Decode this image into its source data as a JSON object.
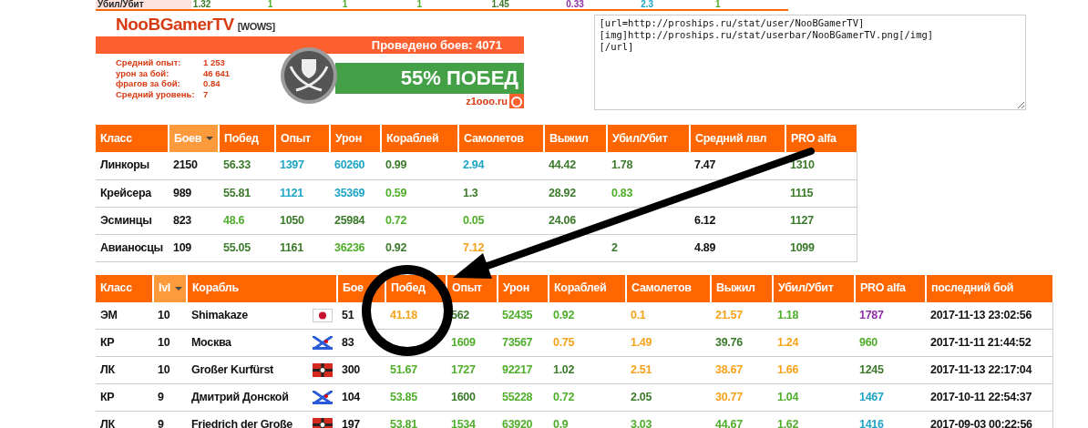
{
  "top_strip": {
    "label": "Убил/Убит",
    "values": [
      {
        "text": "1.32",
        "color": "#3b7a2a"
      },
      {
        "text": "1",
        "color": "#4fae2a"
      },
      {
        "text": "1",
        "color": "#4fae2a"
      },
      {
        "text": "1",
        "color": "#4fae2a"
      },
      {
        "text": "1.45",
        "color": "#3b7a2a"
      },
      {
        "text": "0.33",
        "color": "#8d2fa5"
      },
      {
        "text": "2.3",
        "color": "#1ea5c5"
      },
      {
        "text": "1",
        "color": "#4fae2a"
      }
    ]
  },
  "userbar": {
    "name": "NooBGamerTV",
    "tag": "[WOWS]",
    "battles": "Проведено боев: 4071",
    "stats": [
      {
        "label": "Средний опыт:",
        "value": "1 253"
      },
      {
        "label": "урон за бой:",
        "value": "46 641"
      },
      {
        "label": "фрагов за бой:",
        "value": "0.84"
      },
      {
        "label": "Средний уровень:",
        "value": "7"
      }
    ],
    "wins": "55% ПОБЕД",
    "site": "z1ooo.ru"
  },
  "code_field": {
    "value": "[url=http://proships.ru/stat/user/NooBGamerTV]\n[img]http://proships.ru/stat/userbar/NooBGamerTV.png[/img]\n[/url]"
  },
  "class_table": {
    "columns": [
      {
        "label": "Класс",
        "sorted": false
      },
      {
        "label": "Боев",
        "sorted": true
      },
      {
        "label": "Побед",
        "sorted": false
      },
      {
        "label": "Опыт",
        "sorted": false
      },
      {
        "label": "Урон",
        "sorted": false
      },
      {
        "label": "Кораблей",
        "sorted": false
      },
      {
        "label": "Самолетов",
        "sorted": false
      },
      {
        "label": "Выжил",
        "sorted": false
      },
      {
        "label": "Убил/Убит",
        "sorted": false
      },
      {
        "label": "Средний лвл",
        "sorted": false
      },
      {
        "label": "PRO alfa",
        "sorted": false
      }
    ],
    "rows": [
      {
        "cells": [
          {
            "text": "Линкоры"
          },
          {
            "text": "2150"
          },
          {
            "text": "56.33",
            "color": "#3b7a2a"
          },
          {
            "text": "1397",
            "color": "#1ea5c5"
          },
          {
            "text": "60260",
            "color": "#1ea5c5"
          },
          {
            "text": "0.99",
            "color": "#3b7a2a"
          },
          {
            "text": "2.94",
            "color": "#1ea5c5"
          },
          {
            "text": "44.42",
            "color": "#3b7a2a"
          },
          {
            "text": "1.78",
            "color": "#3b7a2a"
          },
          {
            "text": "7.47",
            "color": "#111111"
          },
          {
            "text": "1310",
            "color": "#3b7a2a"
          }
        ]
      },
      {
        "cells": [
          {
            "text": "Крейсера"
          },
          {
            "text": "989"
          },
          {
            "text": "55.81",
            "color": "#3b7a2a"
          },
          {
            "text": "1121",
            "color": "#1ea5c5"
          },
          {
            "text": "35369",
            "color": "#1ea5c5"
          },
          {
            "text": "0.59",
            "color": "#4fae2a"
          },
          {
            "text": "1.3",
            "color": "#3b7a2a"
          },
          {
            "text": "28.92",
            "color": "#3b7a2a"
          },
          {
            "text": "0.83",
            "color": "#4fae2a"
          },
          {
            "text": ""
          },
          {
            "text": "1115",
            "color": "#3b7a2a"
          }
        ]
      },
      {
        "cells": [
          {
            "text": "Эсминцы"
          },
          {
            "text": "823"
          },
          {
            "text": "48.6",
            "color": "#4fae2a"
          },
          {
            "text": "1050",
            "color": "#3b7a2a"
          },
          {
            "text": "25984",
            "color": "#3b7a2a"
          },
          {
            "text": "0.72",
            "color": "#4fae2a"
          },
          {
            "text": "0.05",
            "color": "#4fae2a"
          },
          {
            "text": "24.06",
            "color": "#3b7a2a"
          },
          {
            "text": ""
          },
          {
            "text": "6.12",
            "color": "#111111"
          },
          {
            "text": "1127",
            "color": "#3b7a2a"
          }
        ]
      },
      {
        "cells": [
          {
            "text": "Авианосцы"
          },
          {
            "text": "109"
          },
          {
            "text": "55.05",
            "color": "#3b7a2a"
          },
          {
            "text": "1161",
            "color": "#3b7a2a"
          },
          {
            "text": "36236",
            "color": "#4fae2a"
          },
          {
            "text": "0.92",
            "color": "#3b7a2a"
          },
          {
            "text": "7.12",
            "color": "#f7a21b"
          },
          {
            "text": ""
          },
          {
            "text": "2",
            "color": "#3b7a2a"
          },
          {
            "text": "4.89",
            "color": "#111111"
          },
          {
            "text": "1099",
            "color": "#3b7a2a"
          }
        ]
      }
    ]
  },
  "ship_table": {
    "columns": [
      {
        "label": "Класс",
        "sorted": false
      },
      {
        "label": "lvl",
        "sorted": true
      },
      {
        "label": "Корабль",
        "sorted": false
      },
      {
        "label": "Бое",
        "sorted": false
      },
      {
        "label": "Побед",
        "sorted": false
      },
      {
        "label": "Опыт",
        "sorted": false
      },
      {
        "label": "Урон",
        "sorted": false
      },
      {
        "label": "Кораблей",
        "sorted": false
      },
      {
        "label": "Самолетов",
        "sorted": false
      },
      {
        "label": "Выжил",
        "sorted": false
      },
      {
        "label": "Убил/Убит",
        "sorted": false
      },
      {
        "label": "PRO alfa",
        "sorted": false
      },
      {
        "label": "последний бой",
        "sorted": false
      }
    ],
    "rows": [
      {
        "cells": [
          {
            "text": "ЭМ"
          },
          {
            "text": "10"
          },
          {
            "text": "Shimakaze",
            "kind": "japan"
          },
          {
            "text": "51"
          },
          {
            "text": "41.18",
            "color": "#f7a21b"
          },
          {
            "text": "562",
            "color": "#3b7a2a"
          },
          {
            "text": "52435",
            "color": "#4fae2a"
          },
          {
            "text": "0.92",
            "color": "#4fae2a"
          },
          {
            "text": "0.1",
            "color": "#f7a21b"
          },
          {
            "text": "21.57",
            "color": "#f7a21b"
          },
          {
            "text": "1.18",
            "color": "#4fae2a"
          },
          {
            "text": "1787",
            "color": "#8d2fa5"
          },
          {
            "text": "2017-11-13 23:02:56"
          }
        ]
      },
      {
        "cells": [
          {
            "text": "КР"
          },
          {
            "text": "10"
          },
          {
            "text": "Москва",
            "kind": "soviet"
          },
          {
            "text": "83"
          },
          {
            "text": ""
          },
          {
            "text": "1609",
            "color": "#4fae2a"
          },
          {
            "text": "73567",
            "color": "#4fae2a"
          },
          {
            "text": "0.75",
            "color": "#f7a21b"
          },
          {
            "text": "1.49",
            "color": "#f7a21b"
          },
          {
            "text": "39.76",
            "color": "#3b7a2a"
          },
          {
            "text": "1.24",
            "color": "#f7a21b"
          },
          {
            "text": "960",
            "color": "#4fae2a"
          },
          {
            "text": "2017-11-11 21:44:52"
          }
        ]
      },
      {
        "cells": [
          {
            "text": "ЛК"
          },
          {
            "text": "10"
          },
          {
            "text": "Großer Kurfürst",
            "kind": "germany"
          },
          {
            "text": "300"
          },
          {
            "text": "51.67",
            "color": "#4fae2a"
          },
          {
            "text": "1727",
            "color": "#4fae2a"
          },
          {
            "text": "92217",
            "color": "#4fae2a"
          },
          {
            "text": "1.02",
            "color": "#3b7a2a"
          },
          {
            "text": "2.51",
            "color": "#f7a21b"
          },
          {
            "text": "38.67",
            "color": "#f7a21b"
          },
          {
            "text": "1.66",
            "color": "#f7a21b"
          },
          {
            "text": "1245",
            "color": "#3b7a2a"
          },
          {
            "text": "2017-11-13 22:17:04"
          }
        ]
      },
      {
        "cells": [
          {
            "text": "КР"
          },
          {
            "text": "9"
          },
          {
            "text": "Дмитрий Донской",
            "kind": "soviet"
          },
          {
            "text": "104"
          },
          {
            "text": "53.85",
            "color": "#4fae2a"
          },
          {
            "text": "1600",
            "color": "#3b7a2a"
          },
          {
            "text": "55228",
            "color": "#4fae2a"
          },
          {
            "text": "0.72",
            "color": "#4fae2a"
          },
          {
            "text": "2.05",
            "color": "#3b7a2a"
          },
          {
            "text": "30.77",
            "color": "#f7a21b"
          },
          {
            "text": "1.04",
            "color": "#4fae2a"
          },
          {
            "text": "1467",
            "color": "#1ea5c5"
          },
          {
            "text": "2017-10-11 22:54:37"
          }
        ]
      },
      {
        "cells": [
          {
            "text": "ЛК"
          },
          {
            "text": "9"
          },
          {
            "text": "Friedrich der Große",
            "kind": "germany"
          },
          {
            "text": "197"
          },
          {
            "text": "53.81",
            "color": "#4fae2a"
          },
          {
            "text": "1534",
            "color": "#4fae2a"
          },
          {
            "text": "63920",
            "color": "#4fae2a"
          },
          {
            "text": "0.9",
            "color": "#4fae2a"
          },
          {
            "text": "3.03",
            "color": "#4fae2a"
          },
          {
            "text": "44.67",
            "color": "#4fae2a"
          },
          {
            "text": "1.62",
            "color": "#4fae2a"
          },
          {
            "text": "1416",
            "color": "#1ea5c5"
          },
          {
            "text": "2017-09-03 00:22:56"
          }
        ]
      }
    ]
  }
}
